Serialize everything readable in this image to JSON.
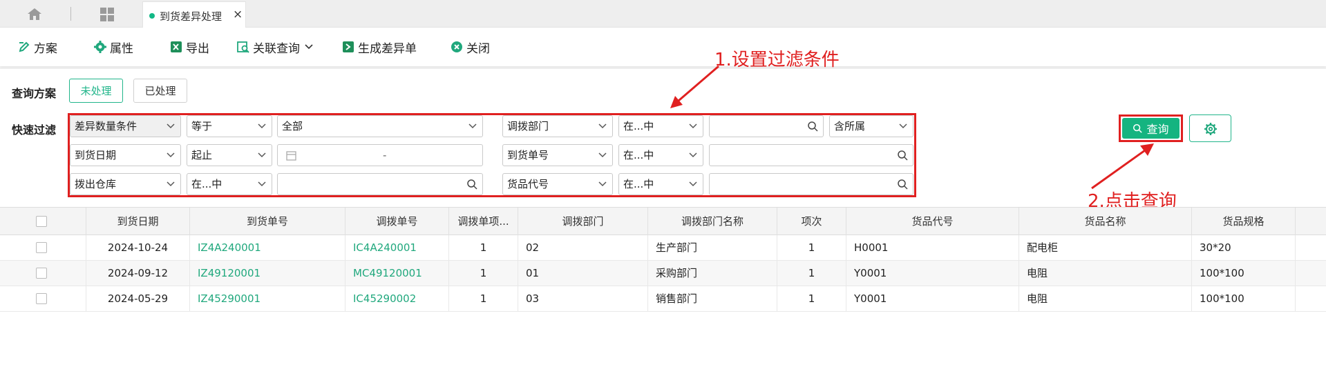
{
  "tabs": {
    "active_label": "到货差异处理",
    "close": "×"
  },
  "toolbar": {
    "items": [
      {
        "label": "方案",
        "icon": "scheme-icon"
      },
      {
        "label": "属性",
        "icon": "gear-icon"
      },
      {
        "label": "导出",
        "icon": "excel-icon"
      },
      {
        "label": "关联查询",
        "icon": "related-query-icon"
      },
      {
        "label": "生成差异单",
        "icon": "generate-icon"
      },
      {
        "label": "关闭",
        "icon": "close-icon"
      }
    ]
  },
  "query_scheme": {
    "label": "查询方案",
    "options": [
      "未处理",
      "已处理"
    ],
    "active": "未处理"
  },
  "quick_filter": {
    "label": "快速过滤",
    "rows": [
      {
        "field": "差异数量条件",
        "op": "等于",
        "value": "全部",
        "field2": "调拨部门",
        "op2": "在...中",
        "value2": "",
        "extra": "含所属"
      },
      {
        "field": "到货日期",
        "op": "起止",
        "range_sep": "-",
        "field2": "到货单号",
        "op2": "在...中",
        "value2": ""
      },
      {
        "field": "拨出仓库",
        "op": "在...中",
        "value": "",
        "field2": "货品代号",
        "op2": "在...中",
        "value2": ""
      }
    ]
  },
  "search_button": "查询",
  "annotations": {
    "step1": "1.设置过滤条件",
    "step2": "2.点击查询"
  },
  "colors": {
    "accent": "#15b480",
    "annotation": "#e02020"
  },
  "table": {
    "columns": [
      "到货日期",
      "到货单号",
      "调拨单号",
      "调拨单项...",
      "调拨部门",
      "调拨部门名称",
      "项次",
      "货品代号",
      "货品名称",
      "货品规格"
    ],
    "rows": [
      [
        "2024-10-24",
        "IZ4A240001",
        "IC4A240001",
        "1",
        "02",
        "生产部门",
        "1",
        "H0001",
        "配电柜",
        "30*20"
      ],
      [
        "2024-09-12",
        "IZ49120001",
        "MC49120001",
        "1",
        "01",
        "采购部门",
        "1",
        "Y0001",
        "电阻",
        "100*100"
      ],
      [
        "2024-05-29",
        "IZ45290001",
        "IC45290002",
        "1",
        "03",
        "销售部门",
        "1",
        "Y0001",
        "电阻",
        "100*100"
      ]
    ]
  }
}
